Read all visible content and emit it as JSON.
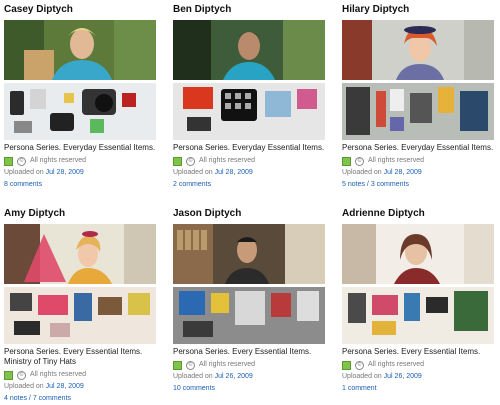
{
  "cards": [
    {
      "title": "Casey Diptych",
      "description": "Persona Series. Everyday Essential Items.",
      "rights": "All rights reserved",
      "uploaded_prefix": "Uploaded on",
      "uploaded_date": "Jul 28, 2009",
      "comments": "8 comments"
    },
    {
      "title": "Ben Diptych",
      "description": "Persona Series. Everyday Essential Items.",
      "rights": "All rights reserved",
      "uploaded_prefix": "Uploaded on",
      "uploaded_date": "Jul 28, 2009",
      "comments": "2 comments"
    },
    {
      "title": "Hilary Diptych",
      "description": "Persona Series. Everyday Essential Items.",
      "rights": "All rights reserved",
      "uploaded_prefix": "Uploaded on",
      "uploaded_date": "Jul 28, 2009",
      "notes": "5 notes",
      "separator": "/",
      "comments": "3 comments"
    },
    {
      "title": "Amy Diptych",
      "description": "Persona Series. Every Essential Items. Ministry of Tiny Hats",
      "rights": "All rights reserved",
      "uploaded_prefix": "Uploaded on",
      "uploaded_date": "Jul 28, 2009",
      "notes": "4 notes",
      "separator": "/",
      "comments": "7 comments"
    },
    {
      "title": "Jason Diptych",
      "description": "Persona Series. Every Essential Items.",
      "rights": "All rights reserved",
      "uploaded_prefix": "Uploaded on",
      "uploaded_date": "Jul 26, 2009",
      "comments": "10 comments"
    },
    {
      "title": "Adrienne Diptych",
      "description": "Persona Series. Every Essential Items.",
      "rights": "All rights reserved",
      "uploaded_prefix": "Uploaded on",
      "uploaded_date": "Jul 26, 2009",
      "comments": "1 comment"
    }
  ]
}
